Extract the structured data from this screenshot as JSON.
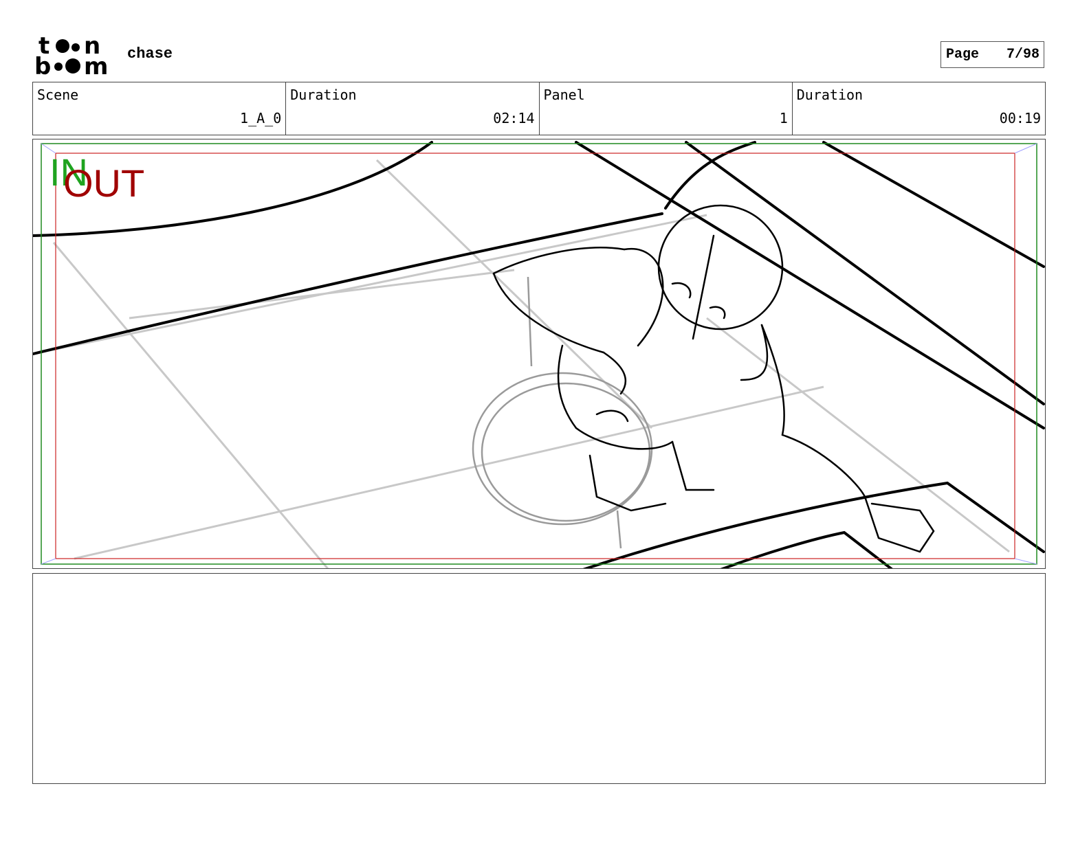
{
  "header": {
    "logo_text": "toon boom",
    "project_title": "chase",
    "page_label": "Page",
    "page_number": "7/98"
  },
  "info": {
    "scene_label": "Scene",
    "scene_value": "1_A_0",
    "scene_duration_label": "Duration",
    "scene_duration_value": "02:14",
    "panel_label": "Panel",
    "panel_value": "1",
    "panel_duration_label": "Duration",
    "panel_duration_value": "00:19"
  },
  "panel": {
    "in_marker": "IN",
    "out_marker": "OUT",
    "colors": {
      "in": "#1fa31f",
      "out": "#a00000",
      "safe_frame_green": "#1f8a1f",
      "safe_frame_red": "#cc2222"
    }
  },
  "notes": {
    "text": ""
  }
}
